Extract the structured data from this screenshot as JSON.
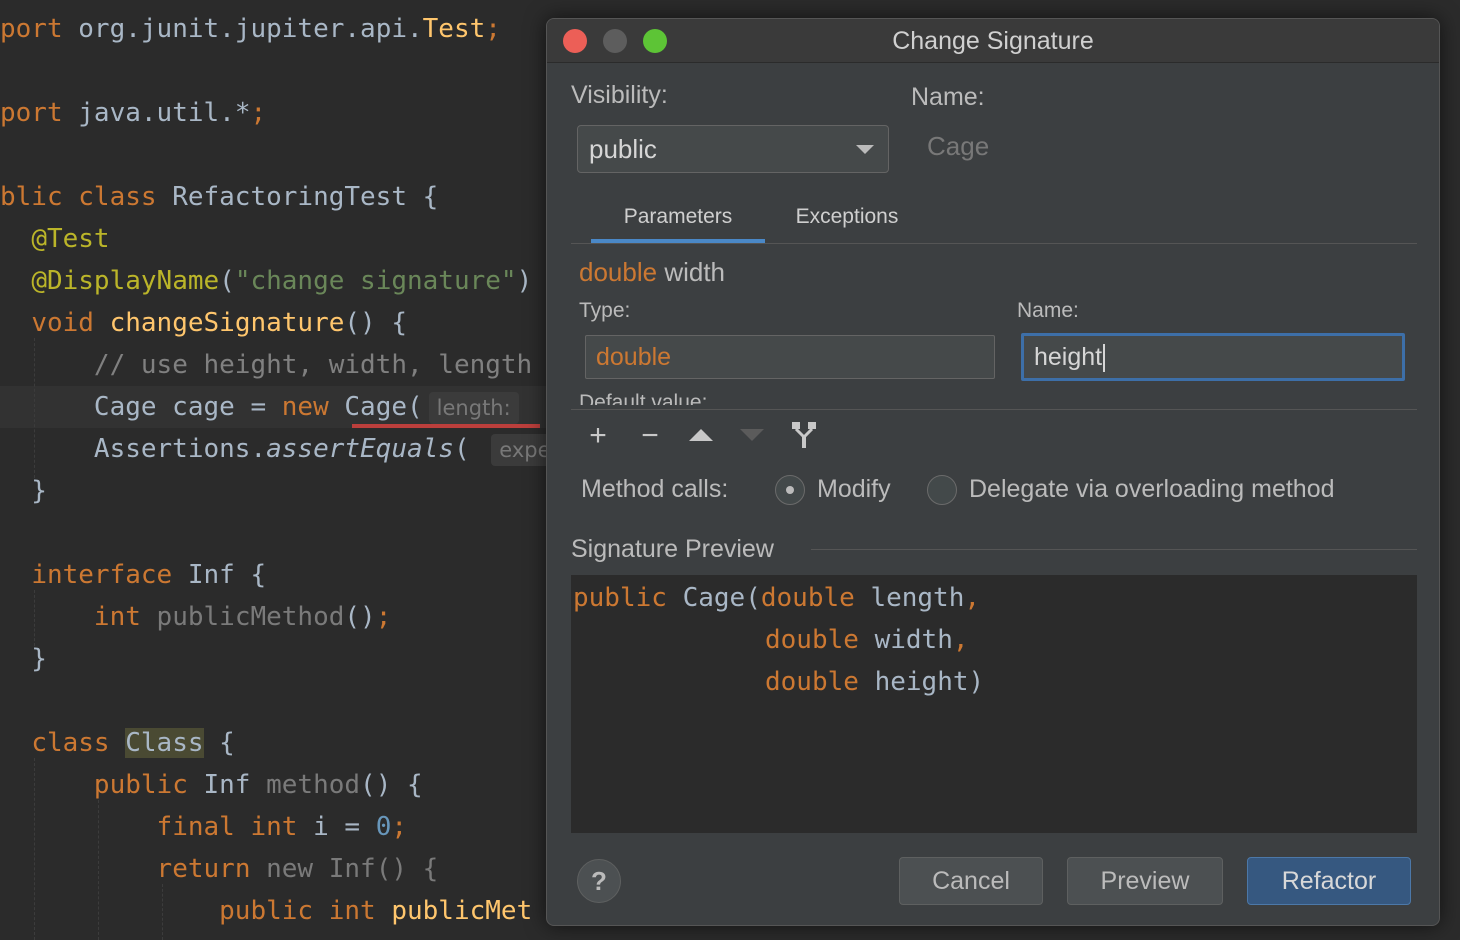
{
  "editor": {
    "lines": [
      {
        "parts": [
          {
            "t": "port ",
            "c": "kw"
          },
          {
            "t": "org.junit.jupiter.api.",
            "c": ""
          },
          {
            "t": "Test",
            "c": "fn"
          },
          {
            "t": ";",
            "c": "kw"
          }
        ]
      },
      {
        "parts": []
      },
      {
        "parts": [
          {
            "t": "port ",
            "c": "kw"
          },
          {
            "t": "java.util.*",
            "c": ""
          },
          {
            "t": ";",
            "c": "kw"
          }
        ]
      },
      {
        "parts": []
      },
      {
        "parts": [
          {
            "t": "blic class ",
            "c": "kw"
          },
          {
            "t": "RefactoringTest {",
            "c": ""
          }
        ]
      },
      {
        "parts": [
          {
            "t": "  ",
            "c": ""
          },
          {
            "t": "@Test",
            "c": "ann"
          }
        ]
      },
      {
        "parts": [
          {
            "t": "  ",
            "c": ""
          },
          {
            "t": "@DisplayName",
            "c": "ann"
          },
          {
            "t": "(",
            "c": ""
          },
          {
            "t": "\"change signature\"",
            "c": "str"
          },
          {
            "t": ")",
            "c": ""
          }
        ]
      },
      {
        "parts": [
          {
            "t": "  ",
            "c": ""
          },
          {
            "t": "void ",
            "c": "kw"
          },
          {
            "t": "changeSignature",
            "c": "fn"
          },
          {
            "t": "() {",
            "c": ""
          }
        ]
      },
      {
        "parts": [
          {
            "t": "      ",
            "c": ""
          },
          {
            "t": "// use height, width, length",
            "c": "cmt"
          }
        ]
      },
      {
        "parts": [
          {
            "t": "      Cage cage = ",
            "c": ""
          },
          {
            "t": "new ",
            "c": "kw"
          },
          {
            "t": "Cage(",
            "c": ""
          },
          {
            "t": "length:",
            "c": "hint"
          }
        ]
      },
      {
        "parts": [
          {
            "t": "      Assertions.",
            "c": ""
          },
          {
            "t": "assertEquals",
            "c": "it"
          },
          {
            "t": "( ",
            "c": ""
          },
          {
            "t": "expe",
            "c": "hint"
          }
        ]
      },
      {
        "parts": [
          {
            "t": "  }",
            "c": ""
          }
        ]
      },
      {
        "parts": []
      },
      {
        "parts": [
          {
            "t": "  ",
            "c": ""
          },
          {
            "t": "interface ",
            "c": "kw"
          },
          {
            "t": "Inf {",
            "c": ""
          }
        ]
      },
      {
        "parts": [
          {
            "t": "      ",
            "c": ""
          },
          {
            "t": "int ",
            "c": "kw"
          },
          {
            "t": "publicMethod",
            "c": "dim"
          },
          {
            "t": "()",
            "c": ""
          },
          {
            "t": ";",
            "c": "kw"
          }
        ]
      },
      {
        "parts": [
          {
            "t": "  }",
            "c": ""
          }
        ]
      },
      {
        "parts": []
      },
      {
        "parts": [
          {
            "t": "  ",
            "c": ""
          },
          {
            "t": "class ",
            "c": "kw"
          },
          {
            "t": "Class",
            "c": "classhl"
          },
          {
            "t": " {",
            "c": ""
          }
        ]
      },
      {
        "parts": [
          {
            "t": "      ",
            "c": ""
          },
          {
            "t": "public ",
            "c": "kw"
          },
          {
            "t": "Inf ",
            "c": ""
          },
          {
            "t": "method",
            "c": "dim"
          },
          {
            "t": "() {",
            "c": ""
          }
        ]
      },
      {
        "parts": [
          {
            "t": "          ",
            "c": ""
          },
          {
            "t": "final int ",
            "c": "kw"
          },
          {
            "t": "i = ",
            "c": ""
          },
          {
            "t": "0",
            "c": "num"
          },
          {
            "t": ";",
            "c": "kw"
          }
        ]
      },
      {
        "parts": [
          {
            "t": "          ",
            "c": ""
          },
          {
            "t": "return ",
            "c": "kw"
          },
          {
            "t": "new Inf() {",
            "c": "dim"
          }
        ]
      },
      {
        "parts": [
          {
            "t": "              ",
            "c": ""
          },
          {
            "t": "public int ",
            "c": "kw"
          },
          {
            "t": "publicMet",
            "c": "fn"
          }
        ]
      }
    ]
  },
  "dialog": {
    "title": "Change Signature",
    "visibility_label": "Visibility:",
    "visibility_value": "public",
    "name_label": "Name:",
    "name_value": "Cage",
    "tabs": {
      "parameters": "Parameters",
      "exceptions": "Exceptions"
    },
    "param_title_type": "double",
    "param_title_name": "width",
    "type_label": "Type:",
    "type_value": "double",
    "param_name_label": "Name:",
    "param_name_value": "height",
    "default_value_label": "Default value:",
    "toolbar": {
      "add": "+",
      "remove": "−"
    },
    "method_calls_label": "Method calls:",
    "modify_label": "Modify",
    "delegate_label": "Delegate via overloading method",
    "signature_preview_label": "Signature Preview",
    "preview": {
      "l1_kw": "public ",
      "l1_rest": "Cage(",
      "l1_type": "double ",
      "l1_name": "length",
      "l1_end": ",",
      "l2_type": "double ",
      "l2_name": "width",
      "l2_end": ",",
      "l3_type": "double ",
      "l3_name": "height)"
    },
    "help": "?",
    "cancel": "Cancel",
    "preview_btn": "Preview",
    "refactor": "Refactor"
  },
  "colors": {
    "keyword": "#cc7832",
    "function": "#ffc66d",
    "string": "#6a8759",
    "annotation": "#bbb529",
    "number": "#6897bb",
    "accent": "#4a88c7",
    "refactor_button": "#365880",
    "error_underline": "#bc3f3c"
  }
}
